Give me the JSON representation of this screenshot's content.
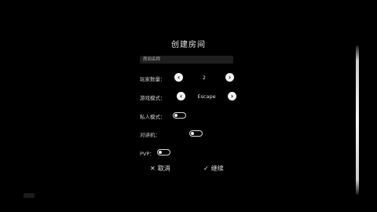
{
  "dialog": {
    "title": "创建房间",
    "room_name_placeholder": "房间名称",
    "player_count": {
      "label": "玩家数量：",
      "value": "2",
      "prev_icon": "chevron-left-icon",
      "next_icon": "chevron-right-icon"
    },
    "game_mode": {
      "label": "游戏模式：",
      "value": "Escape",
      "prev_icon": "chevron-left-icon",
      "next_icon": "chevron-right-icon"
    },
    "private_mode": {
      "label": "私人模式：",
      "enabled": false
    },
    "walkie_talkie": {
      "label": "对讲机：",
      "enabled": false
    },
    "pvp": {
      "label": "PVP：",
      "enabled": false
    },
    "cancel": {
      "glyph": "✕",
      "label": "取消"
    },
    "confirm": {
      "glyph": "✓",
      "label": "继续"
    }
  },
  "colors": {
    "background": "#000000",
    "button_fill": "#f2f2f2",
    "field_fill": "#1e1e1e",
    "text": "#d8d8d8"
  }
}
